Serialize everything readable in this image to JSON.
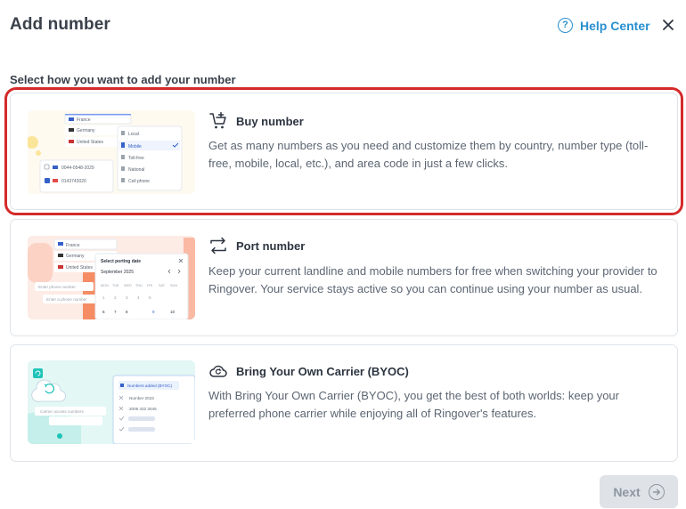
{
  "header": {
    "title": "Add number",
    "help_label": "Help Center",
    "help_icon": "question-circle-icon",
    "close_icon": "close-icon"
  },
  "subtitle": "Select how you want to add your number",
  "options": [
    {
      "id": "buy",
      "icon": "cart-plus-icon",
      "title": "Buy number",
      "description": "Get as many numbers as you need and customize them by country, number type (toll-free, mobile, local, etc.), and area code in just a few clicks.",
      "selected": true,
      "illustration": {
        "countries": [
          "France",
          "Germany",
          "United States"
        ],
        "types": [
          "Local",
          "Mobile",
          "Toll-free",
          "National",
          "Cell phone"
        ],
        "numbers": [
          "0044-0548-2029",
          "0143743020"
        ]
      }
    },
    {
      "id": "port",
      "icon": "swap-arrows-icon",
      "title": "Port number",
      "description": "Keep your current landline and mobile numbers for free when switching your provider to Ringover. Your service stays active so you can continue using your number as usual.",
      "selected": false,
      "illustration": {
        "countries": [
          "France",
          "Germany",
          "United States"
        ],
        "calendar_title": "Select porting date",
        "calendar_month": "September 2025",
        "weekdays": [
          "MON",
          "TUE",
          "WED",
          "THU",
          "FRI",
          "SAT",
          "SUN"
        ],
        "days": [
          "1",
          "2",
          "3",
          "4",
          "5",
          "6",
          "7",
          "8",
          "9",
          "10"
        ],
        "fields": [
          "Enter phone number",
          "Enter a phone number"
        ]
      }
    },
    {
      "id": "byoc",
      "icon": "cloud-sync-icon",
      "title": "Bring Your Own Carrier (BYOC)",
      "description": "With Bring Your Own Carrier (BYOC), you get the best of both worlds: keep your preferred phone carrier while enjoying all of Ringover's features.",
      "selected": false,
      "illustration": {
        "panel_title": "Numbers added (BYOC)",
        "numbers": [
          "Number 2023",
          "2006 432 3045"
        ],
        "field": "Carrier access numbers"
      }
    }
  ],
  "footer": {
    "next_label": "Next",
    "next_icon": "arrow-right-circle-icon"
  },
  "colors": {
    "accent": "#2a8fd0",
    "selection": "#d42a2a",
    "disabled_bg": "#dfe3e8",
    "disabled_text": "#8e969f"
  }
}
